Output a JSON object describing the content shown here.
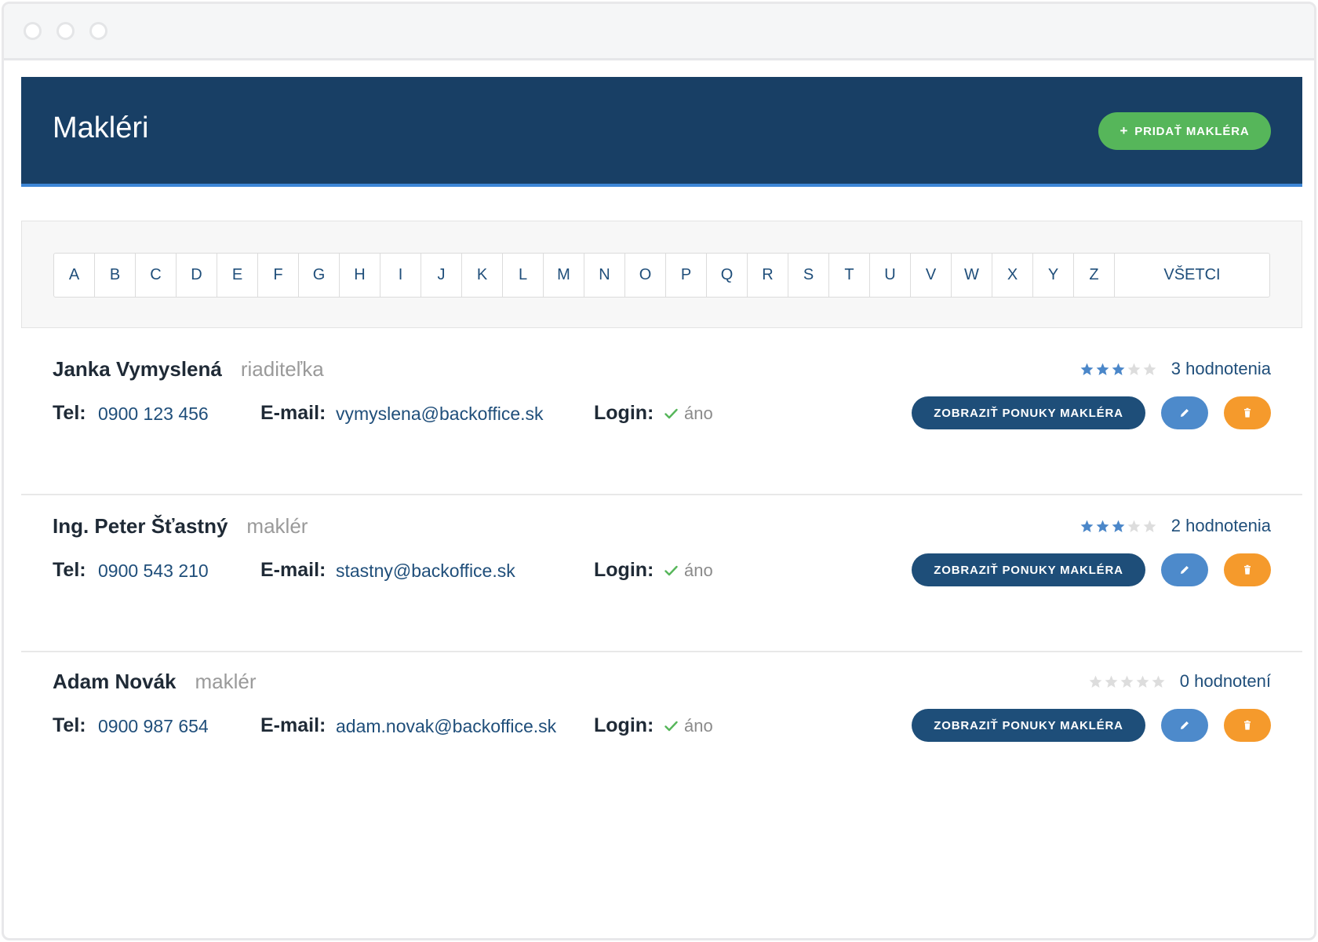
{
  "header": {
    "title": "Makléri",
    "add_button_label": "PRIDAŤ MAKLÉRA"
  },
  "filter": {
    "letters": [
      "A",
      "B",
      "C",
      "D",
      "E",
      "F",
      "G",
      "H",
      "I",
      "J",
      "K",
      "L",
      "M",
      "N",
      "O",
      "P",
      "Q",
      "R",
      "S",
      "T",
      "U",
      "V",
      "W",
      "X",
      "Y",
      "Z"
    ],
    "all_label": "VŠETCI"
  },
  "labels": {
    "tel": "Tel:",
    "email": "E-mail:",
    "login": "Login:",
    "offers_button": "ZOBRAZIŤ PONUKY MAKLÉRA"
  },
  "colors": {
    "header_bg": "#183f65",
    "accent_green": "#56b65a",
    "link_blue": "#1f4e7a",
    "edit_blue": "#4d8acb",
    "delete_orange": "#f59a2c",
    "star_filled": "#4b87c9",
    "star_empty": "#dddddd"
  },
  "brokers": [
    {
      "name": "Janka Vymyslená",
      "role": "riaditeľka",
      "rating": 3,
      "reviews": "3 hodnotenia",
      "tel": "0900 123 456",
      "email": "vymyslena@backoffice.sk",
      "login": "áno"
    },
    {
      "name": "Ing. Peter Šťastný",
      "role": "maklér",
      "rating": 3,
      "reviews": "2 hodnotenia",
      "tel": "0900 543 210",
      "email": "stastny@backoffice.sk",
      "login": "áno"
    },
    {
      "name": "Adam Novák",
      "role": "maklér",
      "rating": 0,
      "reviews": "0 hodnotení",
      "tel": "0900 987 654",
      "email": "adam.novak@backoffice.sk",
      "login": "áno"
    }
  ]
}
